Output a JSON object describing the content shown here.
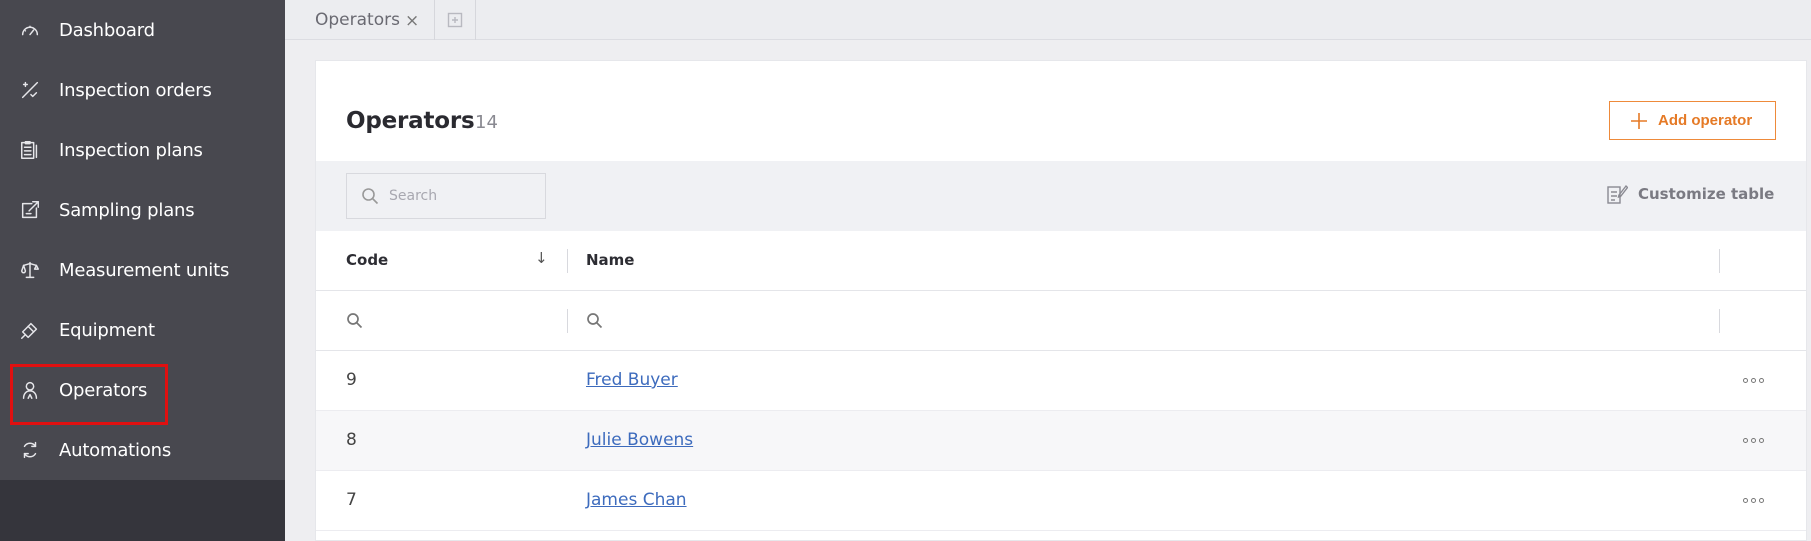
{
  "sidebar": {
    "items": [
      {
        "label": "Dashboard",
        "icon": "dashboard-icon"
      },
      {
        "label": "Inspection orders",
        "icon": "inspection-orders-icon"
      },
      {
        "label": "Inspection plans",
        "icon": "clipboard-icon"
      },
      {
        "label": "Sampling plans",
        "icon": "sampling-icon"
      },
      {
        "label": "Measurement units",
        "icon": "scale-icon"
      },
      {
        "label": "Equipment",
        "icon": "equipment-icon"
      },
      {
        "label": "Operators",
        "icon": "operator-icon"
      },
      {
        "label": "Automations",
        "icon": "refresh-icon"
      }
    ],
    "highlighted": "Operators",
    "highlight_color": "#e01010"
  },
  "tabs": {
    "items": [
      {
        "label": "Operators",
        "close": "×"
      }
    ]
  },
  "page": {
    "title": "Operators",
    "count": "14",
    "add_button": "Add operator"
  },
  "toolbar": {
    "search_placeholder": "Search",
    "customize_label": "Customize table"
  },
  "table": {
    "columns": [
      "Code",
      "Name"
    ],
    "sort_indicator": "↓",
    "rows": [
      {
        "code": "9",
        "name": "Fred Buyer"
      },
      {
        "code": "8",
        "name": "Julie Bowens"
      },
      {
        "code": "7",
        "name": "James Chan"
      }
    ]
  },
  "colors": {
    "sidebar_bg": "#48484f",
    "accent": "#e57a26",
    "link": "#3d6bbd"
  }
}
